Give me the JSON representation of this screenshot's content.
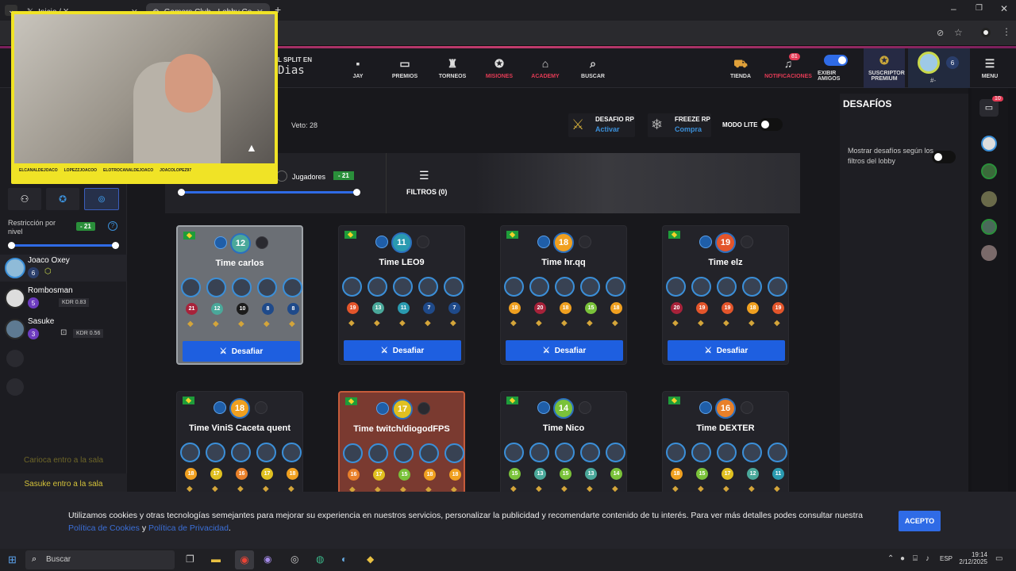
{
  "browser": {
    "tabs": [
      {
        "label": "Inicio / X"
      },
      {
        "label": "Gamers Club - Lobby Counter-"
      }
    ]
  },
  "header": {
    "split_text": "L SPLIT EN",
    "days_text": "Dias",
    "nav": [
      {
        "label": "JAY",
        "icon": "chat-icon"
      },
      {
        "label": "PREMIOS",
        "icon": "ticket-icon"
      },
      {
        "label": "TORNEOS",
        "icon": "trophy-icon"
      },
      {
        "label": "MISIONES",
        "icon": "mission-icon"
      },
      {
        "label": "ACADEMY",
        "icon": "academy-icon"
      },
      {
        "label": "BUSCAR",
        "icon": "search-icon"
      },
      {
        "label": "TIENDA",
        "icon": "cart-icon"
      },
      {
        "label": "NOTIFICACIONES",
        "icon": "bell-icon",
        "count": "81"
      },
      {
        "label": "EXIBIR AMIGOS",
        "icon": "toggle-icon"
      },
      {
        "label": "SUSCRIPTOR PREMIUM",
        "icon": "star-icon"
      },
      {
        "label": "MENU",
        "icon": "menu-icon"
      }
    ],
    "profile_badge": "6",
    "profile_tag": "#-"
  },
  "webcam": {
    "captions": [
      "ELCANALDEJOACO",
      "LOPEZZJOACOO",
      "ELOTROCANALDEJOACO",
      "JOACOLOPEZ97"
    ]
  },
  "sidebar": {
    "restriction_label": "Restricción por nivel",
    "restriction_value": "- 21",
    "players": [
      {
        "name": "Joaco Oxey",
        "level": "6"
      },
      {
        "name": "Rombosman",
        "level": "5",
        "kdr": "KDR 0.83"
      },
      {
        "name": "Sasuke",
        "level": "3",
        "kdr": "KDR 0.56"
      }
    ],
    "events": [
      "Carioca entro a la sala",
      "Sasuke entro a la sala"
    ]
  },
  "lobby": {
    "veto": "Veto: 28",
    "jugadores_label": "Jugadores",
    "jugadores_value": "- 21",
    "filtros": "FILTROS (0)",
    "desafio_rp": {
      "title": "DESAFIO RP",
      "action": "Activar"
    },
    "freeze_rp": {
      "title": "FREEZE RP",
      "action": "Compra"
    },
    "modo_lite": "MODO LITE",
    "challenge_label": "Desafiar",
    "cards": [
      {
        "team": "Time carlos",
        "level": "12",
        "lvls": [
          "21",
          "12",
          "10",
          "8",
          "8"
        ]
      },
      {
        "team": "Time LEO9",
        "level": "11",
        "lvls": [
          "19",
          "13",
          "11",
          "7",
          "7"
        ]
      },
      {
        "team": "Time hr.qq",
        "level": "18",
        "lvls": [
          "18",
          "20",
          "18",
          "15",
          "18"
        ]
      },
      {
        "team": "Time elz",
        "level": "19",
        "lvls": [
          "20",
          "19",
          "19",
          "18",
          "19"
        ]
      },
      {
        "team": "Time ViniS Caceta quent",
        "level": "18",
        "lvls": [
          "18",
          "17",
          "16",
          "17",
          "18"
        ]
      },
      {
        "team": "Time twitch/diogodFPS",
        "level": "17",
        "lvls": [
          "16",
          "17",
          "15",
          "18",
          "18"
        ]
      },
      {
        "team": "Time Nico",
        "level": "14",
        "lvls": [
          "15",
          "13",
          "15",
          "13",
          "14"
        ]
      },
      {
        "team": "Time DEXTER",
        "level": "16",
        "lvls": [
          "18",
          "15",
          "17",
          "12",
          "11"
        ]
      }
    ]
  },
  "right_panel": {
    "title": "DESAFÍOS",
    "toggle_label": "Mostrar desafíos según los filtros del lobby",
    "chat_count": "10"
  },
  "cookie": {
    "text": "Utilizamos cookies y otras tecnologías semejantes para mejorar su experiencia en nuestros servicios, personalizar la publicidad y recomendarte contenido de tu interés. Para ver más detalles podes consultar nuestra",
    "link1": "Política de Cookies",
    "and": "y",
    "link2": "Política de Privacidad",
    "accept": "ACEPTO"
  },
  "taskbar": {
    "search": "Buscar",
    "lang": "ESP",
    "time": "19:14",
    "date": "2/12/2025"
  }
}
